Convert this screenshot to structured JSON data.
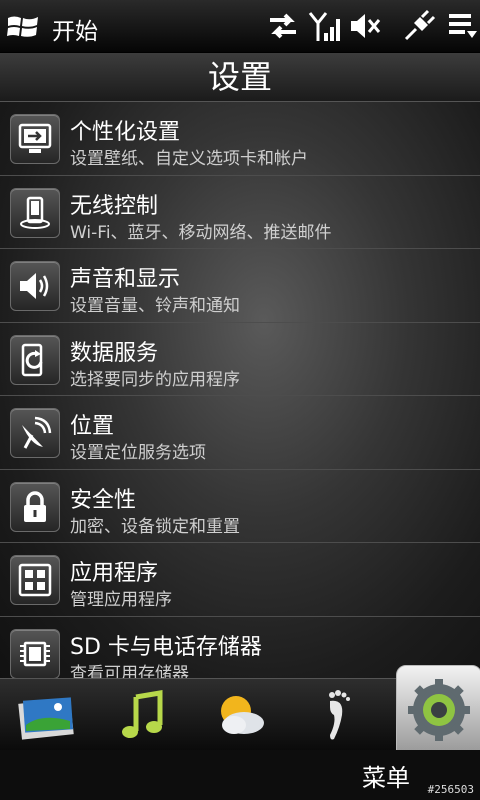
{
  "status_bar": {
    "start_label": "开始",
    "icons": [
      "sync-arrows-icon",
      "signal-icon",
      "volume-mute-icon",
      "power-plug-icon",
      "menu-lines-icon"
    ]
  },
  "title": "设置",
  "settings_items": [
    {
      "title": "个性化设置",
      "subtitle": "设置壁纸、自定义选项卡和帐户",
      "icon": "personalize-icon"
    },
    {
      "title": "无线控制",
      "subtitle": "Wi-Fi、蓝牙、移动网络、推送邮件",
      "icon": "wireless-icon"
    },
    {
      "title": "声音和显示",
      "subtitle": "设置音量、铃声和通知",
      "icon": "speaker-icon"
    },
    {
      "title": "数据服务",
      "subtitle": "选择要同步的应用程序",
      "icon": "data-sync-icon"
    },
    {
      "title": "位置",
      "subtitle": "设置定位服务选项",
      "icon": "satellite-dish-icon"
    },
    {
      "title": "安全性",
      "subtitle": "加密、设备锁定和重置",
      "icon": "lock-icon"
    },
    {
      "title": "应用程序",
      "subtitle": "管理应用程序",
      "icon": "apps-grid-icon"
    },
    {
      "title": "SD 卡与电话存储器",
      "subtitle": "查看可用存储器",
      "icon": "memory-chip-icon"
    }
  ],
  "tab_bar": {
    "tabs": [
      "photos-icon",
      "music-note-icon",
      "weather-icon",
      "footprints-icon",
      "settings-gear-icon"
    ],
    "active_label": "菜单"
  },
  "watermark": "#256503"
}
